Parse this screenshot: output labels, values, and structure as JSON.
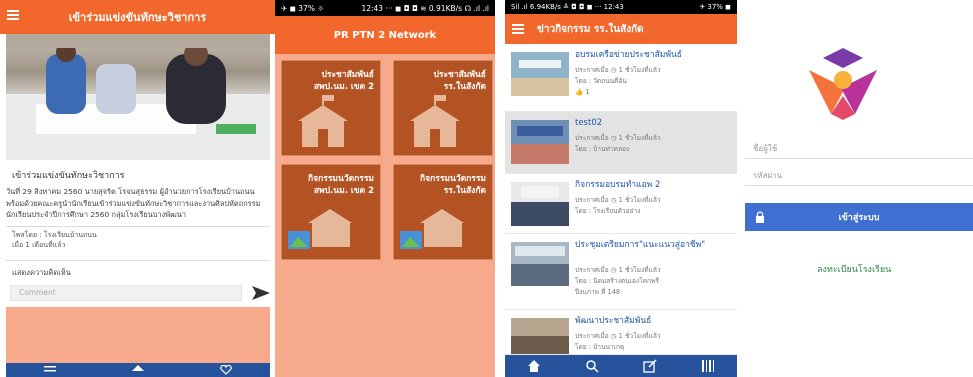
{
  "panel1": {
    "header_title": "เข้าร่วมแข่งขันทักษะวิชาการ",
    "post_title": "เข้าร่วมแข่งขันทักษะวิชาการ",
    "body": "วันที่ 29 สิงหาคม 2560 นายสุจริต โรจนสุธรรม ผู้อำนวยการโรงเรียนบ้านถนนพร้อมด้วยคณะครูนำนักเรียนเข้าร่วมแข่งขันทักษะวิชาการและงานศิลปหัตถกรรมนักเรียนประจำปีการศึกษา 2560 กลุ่มโรงเรียนบางพัฒนา",
    "meta_school": "โพสโดย : โรงเรียนบ้านถนน",
    "meta_time": "เมื่อ 1 เดือนที่แล้ว",
    "comment_header": "แสดงความคิดเห็น",
    "comment_placeholder": "Comment"
  },
  "panel2": {
    "status_left": "✈ ◼ 37% ☼",
    "status_right": "12:43 ··· ◼ ◘ ◘ ≋ 0.91KB/s ☊ .ıl .ıl",
    "header_title": "PR PTN 2 Network",
    "tiles": [
      {
        "line1": "ประชาสัมพันธ์",
        "line2": "สพป.นม. เขต 2"
      },
      {
        "line1": "ประชาสัมพันธ์",
        "line2": "รร.ในสังกัด"
      },
      {
        "line1": "กิจกรรมนวัตกรรม",
        "line2": "สพป.นม. เขต 2"
      },
      {
        "line1": "กิจกรรมนวัตกรรม",
        "line2": "รร.ในสังกัด"
      }
    ]
  },
  "panel3": {
    "status_left": "Sil .ıl 6.94KB/s ≚ ◘ ◘ ◼ ··· 12:43",
    "status_right": "✈ 37% ◼",
    "header_title": "ข่าวกิจกรรม รร.ในสังกัด",
    "items": [
      {
        "title": "อบรมเครือข่ายประชาสัมพันธ์",
        "lines": [
          "ประกาศเมื่อ ◷ 1 ชั่วโมงที่แล้ว",
          "โดย : วัดถนนดีอัน",
          "👍 1"
        ]
      },
      {
        "title": "test02",
        "lines": [
          "ประกาศเมื่อ ◷ 1 ชั่วโมงที่แล้ว",
          "โดย : บ้านท่าคลอง"
        ]
      },
      {
        "title": "กิจกรรมอบรมทำแอพ 2",
        "lines": [
          "ประกาศเมื่อ ◷ 1 ชั่วโมงที่แล้ว",
          "โดย : โรงเรียนตัวอย่าง"
        ]
      },
      {
        "title": "ประชุมเตรียมการ\"แนะแนวสู่อาชีพ\"",
        "lines": [
          "ประกาศเมื่อ ◷ 1 ชั่วโมงที่แล้ว",
          "โดย : นิคมสร้างตนเองโคกพรี",
          "ปีงบภาพ ที่ 148"
        ]
      },
      {
        "title": "พัฒนาประชาสัมพันธ์",
        "lines": [
          "ประกาศเมื่อ ◷ 1 ชั่วโมงที่แล้ว",
          "โดย : บ้านนาเกตุ"
        ]
      }
    ]
  },
  "panel4": {
    "username_placeholder": "ชื่อผู้ใช้",
    "password_placeholder": "รหัสผ่าน",
    "login_label": "เข้าสู่ระบบ",
    "register_label": "ลงทะเบียนโรงเรียน"
  },
  "colors": {
    "orange": "#f2672b",
    "salmon": "#f7a98b",
    "navy": "#26539b",
    "blue_btn": "#3e6fd1",
    "green_link": "#2e8a4a"
  }
}
